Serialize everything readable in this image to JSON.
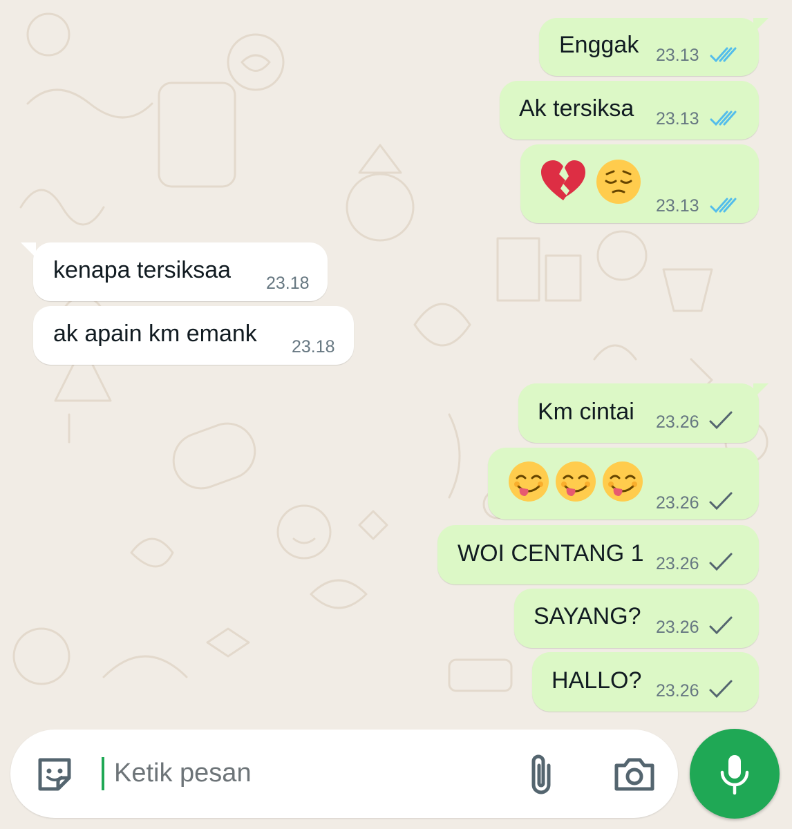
{
  "messages": [
    {
      "direction": "out",
      "text": "Enggak",
      "time": "23.13",
      "status": "read"
    },
    {
      "direction": "out",
      "text": "Ak tersiksa",
      "time": "23.13",
      "status": "read"
    },
    {
      "direction": "out",
      "emojis": [
        "broken-heart",
        "pensive-face"
      ],
      "time": "23.13",
      "status": "read"
    },
    {
      "direction": "in",
      "text": "kenapa tersiksaa",
      "time": "23.18"
    },
    {
      "direction": "in",
      "text": "ak apain km emank",
      "time": "23.18"
    },
    {
      "direction": "out",
      "text": "Km cintai",
      "time": "23.26",
      "status": "sent"
    },
    {
      "direction": "out",
      "emojis": [
        "savoring-food-face",
        "savoring-food-face",
        "savoring-food-face"
      ],
      "time": "23.26",
      "status": "sent"
    },
    {
      "direction": "out",
      "text": "WOI CENTANG 1",
      "time": "23.26",
      "status": "sent"
    },
    {
      "direction": "out",
      "text": "SAYANG?",
      "time": "23.26",
      "status": "sent"
    },
    {
      "direction": "out",
      "text": "HALLO?",
      "time": "23.26",
      "status": "sent"
    }
  ],
  "composer": {
    "placeholder": "Ketik pesan",
    "icons": [
      "sticker-icon",
      "attach-icon",
      "camera-icon",
      "mic-icon"
    ]
  },
  "colors": {
    "outgoing_bubble": "#dcf8c6",
    "incoming_bubble": "#ffffff",
    "read_ticks": "#53bdeb",
    "sent_tick": "#667781",
    "accent_green": "#1fa855",
    "wallpaper": "#f1ece5"
  }
}
